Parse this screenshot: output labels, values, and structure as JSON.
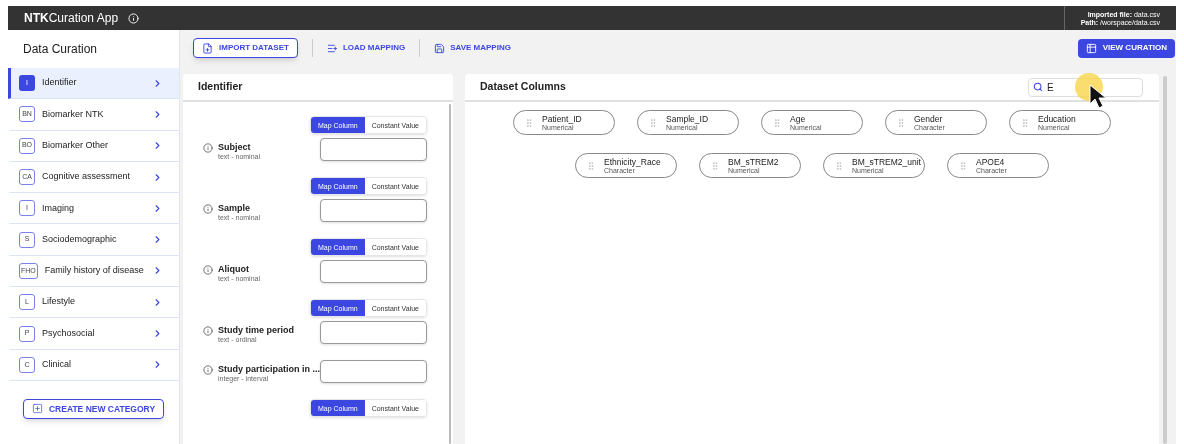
{
  "app": {
    "brand_bold": "NTK",
    "brand_rest": "Curation App",
    "file_label": "Imported file:",
    "file_value": "data.csv",
    "path_label": "Path:",
    "path_value": "/worspace/data.csv"
  },
  "sidebar": {
    "title": "Data Curation",
    "items": [
      {
        "code": "I",
        "label": "Identifier",
        "selected": true
      },
      {
        "code": "BN",
        "label": "Biomarker NTK",
        "selected": false
      },
      {
        "code": "BO",
        "label": "Biomarker Other",
        "selected": false
      },
      {
        "code": "CA",
        "label": "Cognitive assessment",
        "selected": false
      },
      {
        "code": "I",
        "label": "Imaging",
        "selected": false
      },
      {
        "code": "S",
        "label": "Sociodemographic",
        "selected": false
      },
      {
        "code": "FHO",
        "label": "Family history of disease",
        "selected": false
      },
      {
        "code": "L",
        "label": "Lifestyle",
        "selected": false
      },
      {
        "code": "P",
        "label": "Psychosocial",
        "selected": false
      },
      {
        "code": "C",
        "label": "Clinical",
        "selected": false
      }
    ],
    "create_button": "CREATE NEW CATEGORY"
  },
  "toolbar": {
    "import": "IMPORT DATASET",
    "load": "LOAD MAPPING",
    "save": "SAVE MAPPING",
    "view": "VIEW CURATION"
  },
  "form": {
    "title": "Identifier",
    "items": [
      {
        "kind": "toggle",
        "options": [
          {
            "label": "Map Column",
            "selected": true
          },
          {
            "label": "Constant Value",
            "selected": false
          }
        ]
      },
      {
        "kind": "field",
        "label": "Subject",
        "type": "text - nominal"
      },
      {
        "kind": "toggle",
        "options": [
          {
            "label": "Map Column",
            "selected": true
          },
          {
            "label": "Constant Value",
            "selected": false
          }
        ]
      },
      {
        "kind": "field",
        "label": "Sample",
        "type": "text - nominal"
      },
      {
        "kind": "toggle",
        "options": [
          {
            "label": "Map Column",
            "selected": true
          },
          {
            "label": "Constant Value",
            "selected": false
          }
        ]
      },
      {
        "kind": "field",
        "label": "Aliquot",
        "type": "text - nominal"
      },
      {
        "kind": "toggle",
        "options": [
          {
            "label": "Map Column",
            "selected": true
          },
          {
            "label": "Constant Value",
            "selected": false
          }
        ]
      },
      {
        "kind": "field",
        "label": "Study time period",
        "type": "text - ordinal"
      },
      {
        "kind": "field",
        "label": "Study participation in ...",
        "type": "integer - interval"
      },
      {
        "kind": "toggle",
        "options": [
          {
            "label": "Map Column",
            "selected": true
          },
          {
            "label": "Constant Value",
            "selected": false
          }
        ]
      }
    ]
  },
  "columns_panel": {
    "title": "Dataset Columns",
    "search": {
      "value": "E"
    },
    "columns": [
      {
        "name": "Patient_ID",
        "type": "Numerical"
      },
      {
        "name": "Sample_ID",
        "type": "Numerical"
      },
      {
        "name": "Age",
        "type": "Numerical"
      },
      {
        "name": "Gender",
        "type": "Character"
      },
      {
        "name": "Education",
        "type": "Numerical"
      },
      {
        "name": "Ethnicity_Race",
        "type": "Character"
      },
      {
        "name": "BM_sTREM2",
        "type": "Numerical"
      },
      {
        "name": "BM_sTREM2_unit",
        "type": "Numerical"
      },
      {
        "name": "APOE4",
        "type": "Character"
      }
    ]
  }
}
